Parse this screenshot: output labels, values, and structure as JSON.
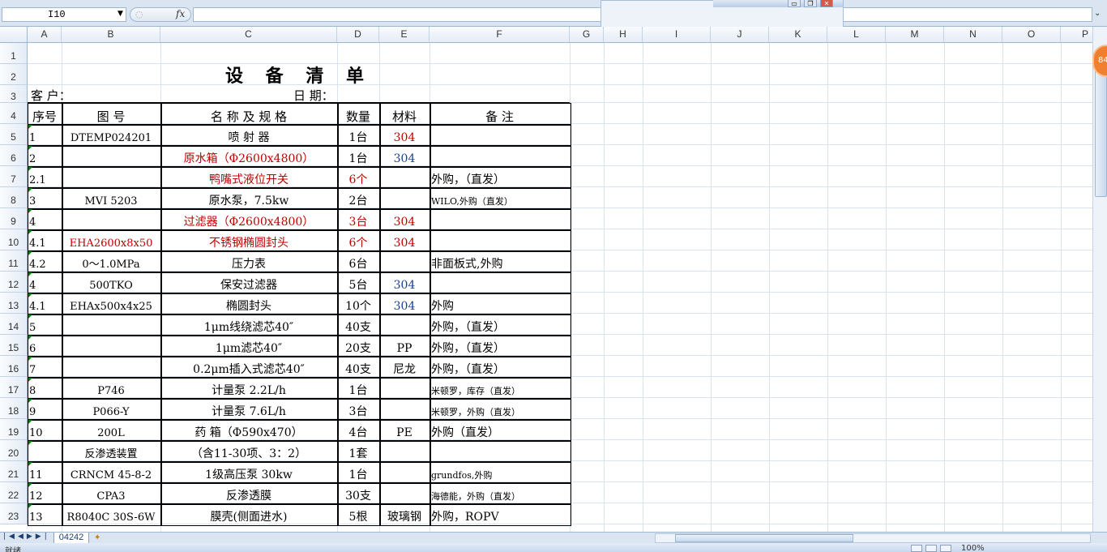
{
  "formula_bar": {
    "name_box": "I10",
    "fx_label": "fx",
    "formula": ""
  },
  "column_headers": [
    "A",
    "B",
    "C",
    "D",
    "E",
    "F",
    "G",
    "H",
    "I",
    "J",
    "K",
    "L",
    "M",
    "N",
    "O",
    "P"
  ],
  "row_headers": [
    "1",
    "2",
    "3",
    "4",
    "5",
    "6",
    "7",
    "8",
    "9",
    "10",
    "11",
    "12",
    "13",
    "14",
    "15",
    "16",
    "17",
    "18",
    "19",
    "20",
    "21",
    "22",
    "23"
  ],
  "sheet": {
    "title": "设 备 清 单",
    "customer_label": "客  户：",
    "date_label": "日  期：",
    "headers": {
      "seq": "序号",
      "drawing": "图        号",
      "name_spec": "名 称 及 规 格",
      "qty": "数量",
      "material": "材料",
      "remark": "备      注"
    },
    "rows": [
      {
        "seq": "1",
        "drawing": "DTEMP024201",
        "name": "喷 射 器",
        "qty": "1台",
        "material": "304",
        "remark": "",
        "name_red": false,
        "qty_red": false,
        "mat_red": true,
        "drawing_red": false
      },
      {
        "seq": "2",
        "drawing": "",
        "name": "原水箱（Φ2600x4800）",
        "qty": "1台",
        "material": "304",
        "remark": "",
        "name_red": true,
        "qty_red": false,
        "mat_red": false,
        "drawing_red": false
      },
      {
        "seq": "2.1",
        "drawing": "",
        "name": "鸭嘴式液位开关",
        "qty": "6个",
        "material": "",
        "remark": "外购，（直发）",
        "name_red": true,
        "qty_red": true,
        "mat_red": false,
        "drawing_red": false
      },
      {
        "seq": "3",
        "drawing": "MVI 5203",
        "name": "原水泵，7.5kw",
        "qty": "2台",
        "material": "",
        "remark": "WILO,外购（直发）",
        "name_red": false,
        "qty_red": false,
        "mat_red": false,
        "drawing_red": false
      },
      {
        "seq": "4",
        "drawing": "",
        "name": "过滤器（Φ2600x4800）",
        "qty": "3台",
        "material": "304",
        "remark": "",
        "name_red": true,
        "qty_red": true,
        "mat_red": true,
        "drawing_red": false
      },
      {
        "seq": "4.1",
        "drawing": "EHA2600x8x50",
        "name": "不锈钢椭圆封头",
        "qty": "6个",
        "material": "304",
        "remark": "",
        "name_red": true,
        "qty_red": true,
        "mat_red": true,
        "drawing_red": true
      },
      {
        "seq": "4.2",
        "drawing": "0～1.0MPa",
        "name": "压力表",
        "qty": "6台",
        "material": "",
        "remark": "非面板式,外购",
        "name_red": false,
        "qty_red": false,
        "mat_red": false,
        "drawing_red": false
      },
      {
        "seq": "4",
        "drawing": "500TKO",
        "name": "保安过滤器",
        "qty": "5台",
        "material": "304",
        "remark": "",
        "name_red": false,
        "qty_red": false,
        "mat_red": false,
        "drawing_red": false
      },
      {
        "seq": "4.1",
        "drawing": "EHAx500x4x25",
        "name": "椭圆封头",
        "qty": "10个",
        "material": "304",
        "remark": "外购",
        "name_red": false,
        "qty_red": false,
        "mat_red": false,
        "drawing_red": false
      },
      {
        "seq": "5",
        "drawing": "",
        "name": "1μm线绕滤芯40″",
        "qty": "40支",
        "material": "",
        "remark": "外购，（直发）",
        "name_red": false,
        "qty_red": false,
        "mat_red": false,
        "drawing_red": false
      },
      {
        "seq": "6",
        "drawing": "",
        "name": "1μm滤芯40″",
        "qty": "20支",
        "material": "PP",
        "remark": "外购，（直发）",
        "name_red": false,
        "qty_red": false,
        "mat_red": false,
        "drawing_red": false
      },
      {
        "seq": "7",
        "drawing": "",
        "name": "0.2μm插入式滤芯40″",
        "qty": "40支",
        "material": "尼龙",
        "remark": "外购，（直发）",
        "name_red": false,
        "qty_red": false,
        "mat_red": false,
        "drawing_red": false
      },
      {
        "seq": "8",
        "drawing": "P746",
        "name": "计量泵 2.2L/h",
        "qty": "1台",
        "material": "",
        "remark": "米顿罗，库存（直发）",
        "name_red": false,
        "qty_red": false,
        "mat_red": false,
        "drawing_red": false
      },
      {
        "seq": "9",
        "drawing": "P066-Y",
        "name": "计量泵 7.6L/h",
        "qty": "3台",
        "material": "",
        "remark": "米顿罗，外购（直发）",
        "name_red": false,
        "qty_red": false,
        "mat_red": false,
        "drawing_red": false
      },
      {
        "seq": "10",
        "drawing": "200L",
        "name": "药 箱（Φ590x470）",
        "qty": "4台",
        "material": "PE",
        "remark": "外购（直发）",
        "name_red": false,
        "qty_red": false,
        "mat_red": false,
        "drawing_red": false
      },
      {
        "seq": "",
        "drawing": "反渗透装置",
        "name": "（含11-30项、3：2）",
        "qty": "1套",
        "material": "",
        "remark": "",
        "name_red": false,
        "qty_red": false,
        "mat_red": false,
        "drawing_red": false
      },
      {
        "seq": "11",
        "drawing": "CRNCM 45-8-2",
        "name": "1级高压泵  30kw",
        "qty": "1台",
        "material": "",
        "remark": "grundfos,外购",
        "name_red": false,
        "qty_red": false,
        "mat_red": false,
        "drawing_red": false
      },
      {
        "seq": "12",
        "drawing": "CPA3",
        "name": "反渗透膜",
        "qty": "30支",
        "material": "",
        "remark": "海德能，外购（直发）",
        "name_red": false,
        "qty_red": false,
        "mat_red": false,
        "drawing_red": false
      },
      {
        "seq": "13",
        "drawing": "R8040C 30S-6W",
        "name": "膜壳(侧面进水)",
        "qty": "5根",
        "material": "玻璃钢",
        "remark": "外购，ROPV",
        "name_red": false,
        "qty_red": false,
        "mat_red": false,
        "drawing_red": false
      }
    ]
  },
  "sheet_tab": "04242",
  "badge": "84",
  "status": {
    "ready": "就绪",
    "zoom": "100%"
  }
}
